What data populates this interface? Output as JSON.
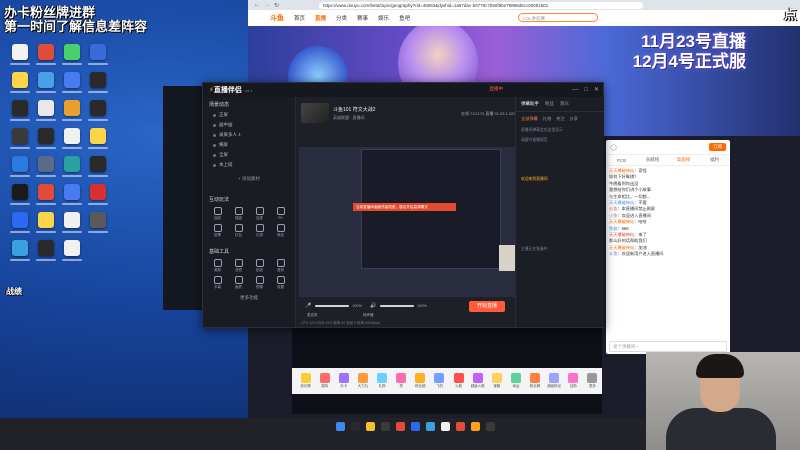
{
  "overlay": {
    "line1": "办卡粉丝牌进群",
    "line2": "第一时间了解信息差阵容",
    "bottom_left": "战绩",
    "right_edge": "点"
  },
  "desktop": {
    "icon_colors": [
      "#f2f2f2",
      "#e24a3a",
      "#4ad06a",
      "#3a6ad8",
      "#fbd44a",
      "#4aa0e8",
      "#4a7af0",
      "#2a2a2a",
      "#2a2a2a",
      "#e8e8e8",
      "#e8a030",
      "#2a2a2a",
      "#3a3a3a",
      "#2a2a2a",
      "#f0f0f0",
      "#fbd44a",
      "#2a7ae0",
      "#5a6a8a",
      "#2aa0a0",
      "#2a2a2a",
      "#1a1a1a",
      "#e24a3a",
      "#4a7af0",
      "#d83030",
      "#2a6af0",
      "#fbd44a",
      "#f0f0f0",
      "#5a5a5a",
      "#3aa0e0",
      "#2a2a2a",
      "#f0f0f0"
    ]
  },
  "browser": {
    "url": "https://www.douyu.com/beta/topic/geography?rid=46053&dyshid=1a67dac-b0778c7b50f9be79898d5cc00051601",
    "site_name": "斗鱼",
    "nav": [
      "首页",
      "直播",
      "分类",
      "赛事",
      "娱乐",
      "鱼吧"
    ],
    "search_placeholder": "LOL季前赛",
    "banner_line1": "11月23号直播",
    "banner_line2": "12月4号正式服",
    "chat": {
      "tabs": [
        "PCB",
        "贡献榜",
        "高能榜",
        "福利"
      ],
      "subscribe": "订阅",
      "lines": [
        {
          "user": "天天爆破神仙",
          "text": "：奇怪"
        },
        {
          "user": "",
          "text": "如何下好象棋？"
        },
        {
          "user": "",
          "text": "今晚看到你出没"
        },
        {
          "user": "",
          "text": "我想给你们讲个小故事"
        },
        {
          "user": "",
          "text": "与生命相比，一切都..."
        },
        {
          "user": "天天爆破神仙",
          "text": "：不要"
        },
        {
          "user": "公告",
          "text": "：本直播间禁止刷屏"
        },
        {
          "user": "小鱼",
          "text": "：欢迎进入直播间"
        },
        {
          "user": "天天爆破神仙",
          "text": "：哈哈"
        },
        {
          "user": "鱼粉",
          "text": "：666"
        },
        {
          "user": "天天爆破神仙",
          "text": "：来了"
        },
        {
          "user": "",
          "text": "那么好的话帮助我们"
        },
        {
          "user": "天天爆破神仙",
          "text": "：加油"
        },
        {
          "user": "斗鱼",
          "text": "：欢迎新用户进入直播间"
        }
      ],
      "input_placeholder": "发个弹幕呗~"
    },
    "gifts": [
      "荧光棒",
      "弱鸡",
      "办卡",
      "大力丸",
      "礼物",
      "赞",
      "粉丝团",
      "飞机",
      "火箭",
      "超级火箭",
      "宝箱",
      "幸运",
      "粉丝牌",
      "超级粉丝",
      "钻粉",
      "更多"
    ]
  },
  "app": {
    "logo": "直播伴侣",
    "version": "v4.1",
    "live_status": "直播中",
    "scene_section": "场景动态",
    "scenes": [
      "正屏",
      "画中画",
      "录屏多人 1",
      "横屏",
      "全屏",
      "本上班"
    ],
    "add_source": "+ 添加素材",
    "interact_section": "互动玩法",
    "interact_tools": [
      "抽奖",
      "福袋",
      "连麦",
      "PK",
      "投票",
      "红包",
      "礼物",
      "商品"
    ],
    "basic_section": "基础工具",
    "basic_tools": [
      "美颜",
      "滤镜",
      "贴纸",
      "音效",
      "字幕",
      "画质",
      "镜像",
      "设置"
    ],
    "more": "更多功能",
    "stream_title": "斗鱼101 符文大战2",
    "stream_sub": "英雄联盟 · 直播间",
    "stats": "在线 71/1174   直播 01:33   1.0234",
    "alert_text": "当前直播间画面质量较差，建议开启高清模式",
    "mic_label": "麦克风",
    "mic_pct": "100%",
    "speaker_label": "扬声器",
    "speaker_pct": "100%",
    "mic_level": 1.0,
    "speaker_level": 1.0,
    "start_btn": "开始直播",
    "right_tabs": [
      "弹幕助手",
      "粉丝",
      "观众"
    ],
    "right_sub": [
      "全部弹幕",
      "礼物",
      "关注",
      "分享"
    ],
    "right_text": [
      "直播间弹幕会在这里显示",
      "请遵守直播规范",
      "欢迎来到直播间",
      "主播正在准备中"
    ],
    "status": "CPU 12%   内存 45%   帧率 60   丢帧 0   码率 6000kbps"
  },
  "taskbar": {
    "icon_colors": [
      "#3a8af0",
      "#2a2a2a",
      "#f2c030",
      "#3a3a3a",
      "#e24a3a",
      "#2a6af0",
      "#3aa0e0",
      "#f0f0f0",
      "#e24a3a",
      "#ffa020",
      "#3a3a3a"
    ],
    "tray": "26"
  }
}
